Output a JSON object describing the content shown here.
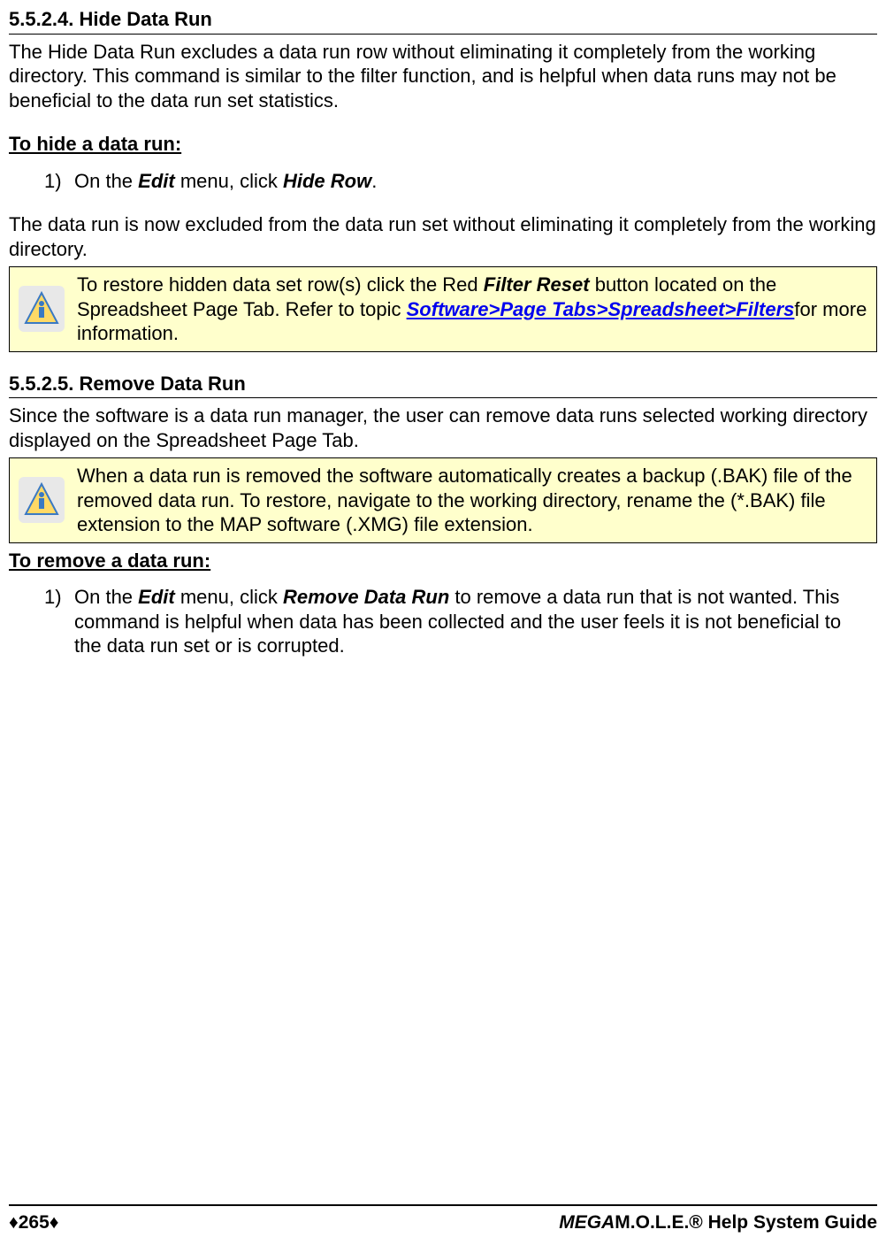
{
  "section1": {
    "heading": "5.5.2.4. Hide Data Run",
    "para1": "The Hide Data Run excludes a data run row without eliminating it completely from the working directory. This command is similar to the filter function, and is helpful when data runs may not be beneficial to the data run set statistics.",
    "subheading": "To hide a data run:",
    "step1_num": "1)",
    "step1_prefix": "On the ",
    "step1_menu": "Edit",
    "step1_mid": " menu, click ",
    "step1_cmd": "Hide Row",
    "step1_suffix": ".",
    "para2": "The data run is now excluded from the data run set without eliminating it completely from the working directory.",
    "note_prefix": "To restore hidden data set row(s) click the Red ",
    "note_bold1": "Filter Reset",
    "note_mid1": " button located on the Spreadsheet Page Tab. Refer to topic  ",
    "note_link": "Software>Page Tabs>Spreadsheet>Filters",
    "note_suffix": "for more information."
  },
  "section2": {
    "heading": "5.5.2.5. Remove Data Run",
    "para1": "Since the software is a data run manager, the user can remove data runs selected working directory displayed on the Spreadsheet Page Tab.",
    "note": "When a data run is removed the software automatically creates a backup (.BAK) file of the removed data run. To restore, navigate to the working directory, rename the (*.BAK) file extension to the MAP software (.XMG) file extension.",
    "subheading": "To remove a data run:",
    "step1_num": "1)",
    "step1_prefix": "On the ",
    "step1_menu": "Edit",
    "step1_mid": " menu, click ",
    "step1_cmd": "Remove Data Run",
    "step1_suffix": " to remove a data run that is not wanted. This command is helpful when data has been collected and the user feels it is not beneficial to the data run set or is corrupted."
  },
  "footer": {
    "page": "♦265♦",
    "title_prefix": "MEGA",
    "title_suffix": "M.O.L.E.® Help System Guide"
  }
}
